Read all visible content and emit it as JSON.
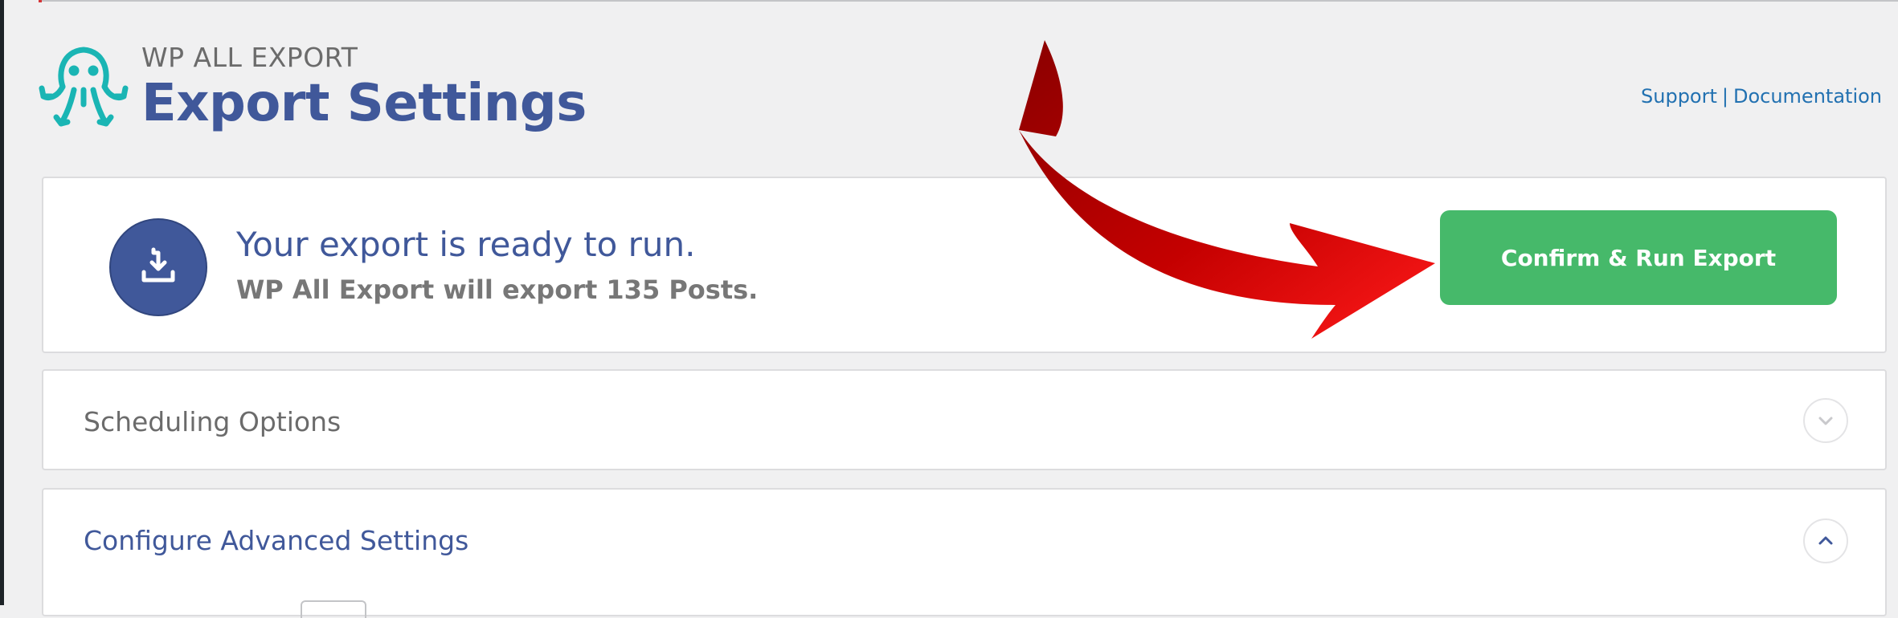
{
  "header": {
    "brand": "WP ALL EXPORT",
    "title": "Export Settings",
    "links": {
      "support": "Support",
      "separator": "|",
      "documentation": "Documentation"
    },
    "logo_icon": "octopus-logo-icon",
    "logo_color": "#1ab5b4"
  },
  "ready_panel": {
    "icon": "download-icon",
    "title": "Your export is ready to run.",
    "subtitle": "WP All Export will export 135 Posts.",
    "run_button": "Confirm & Run Export",
    "button_color": "#46b96a"
  },
  "scheduling": {
    "label": "Scheduling Options",
    "toggle_icon": "chevron-down-icon"
  },
  "advanced": {
    "label": "Configure Advanced Settings",
    "toggle_icon": "chevron-up-icon"
  },
  "annotation": {
    "arrow_icon": "red-arrow-annotation",
    "arrow_color": "#d40000"
  },
  "colors": {
    "accent": "#40589a",
    "background": "#f0f0f1",
    "link": "#2271b1"
  }
}
